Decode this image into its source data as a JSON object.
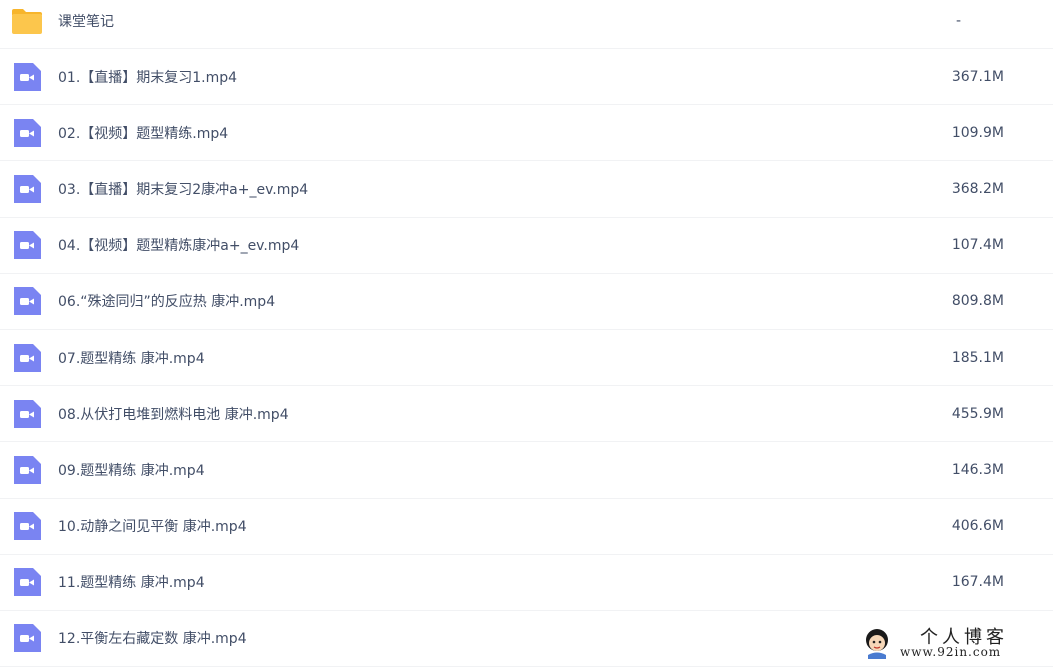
{
  "files": [
    {
      "type": "folder",
      "name": "课堂笔记",
      "size": "-"
    },
    {
      "type": "video",
      "name": "01.【直播】期末复习1.mp4",
      "size": "367.1M"
    },
    {
      "type": "video",
      "name": "02.【视频】题型精练.mp4",
      "size": "109.9M"
    },
    {
      "type": "video",
      "name": "03.【直播】期末复习2康冲a+_ev.mp4",
      "size": "368.2M"
    },
    {
      "type": "video",
      "name": "04.【视频】题型精炼康冲a+_ev.mp4",
      "size": "107.4M"
    },
    {
      "type": "video",
      "name": "06.“殊途同归”的反应热 康冲.mp4",
      "size": "809.8M"
    },
    {
      "type": "video",
      "name": "07.题型精练 康冲.mp4",
      "size": "185.1M"
    },
    {
      "type": "video",
      "name": "08.从伏打电堆到燃料电池 康冲.mp4",
      "size": "455.9M"
    },
    {
      "type": "video",
      "name": "09.题型精练 康冲.mp4",
      "size": "146.3M"
    },
    {
      "type": "video",
      "name": "10.动静之间见平衡 康冲.mp4",
      "size": "406.6M"
    },
    {
      "type": "video",
      "name": "11.题型精练 康冲.mp4",
      "size": "167.4M"
    },
    {
      "type": "video",
      "name": "12.平衡左右藏定数 康冲.mp4",
      "size": ""
    }
  ],
  "watermark": {
    "title": "个人博客",
    "url": "www.92in.com"
  },
  "colors": {
    "folder": "#fcc64c",
    "folder_tab": "#f7b52c",
    "video": "#7a84f2",
    "text": "#424e67"
  }
}
